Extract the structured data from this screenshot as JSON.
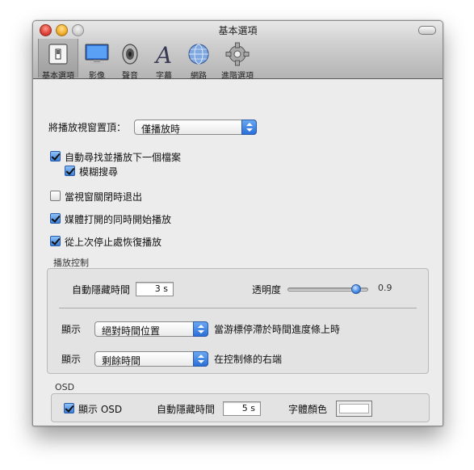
{
  "window": {
    "title": "基本選項"
  },
  "toolbar": {
    "items": [
      {
        "label": "基本選項",
        "icon": "switch-icon"
      },
      {
        "label": "影像",
        "icon": "monitor-icon"
      },
      {
        "label": "聲音",
        "icon": "speaker-icon"
      },
      {
        "label": "字幕",
        "icon": "letter-a-icon"
      },
      {
        "label": "網路",
        "icon": "globe-icon"
      },
      {
        "label": "進階選項",
        "icon": "gear-icon"
      }
    ],
    "selected": "基本選項"
  },
  "general": {
    "ontop_label": "將播放視窗置頂：",
    "ontop_value": "僅播放時",
    "auto_next_label": "自動尋找並播放下一個檔案",
    "auto_next_checked": true,
    "fuzzy_label": "模糊搜尋",
    "fuzzy_checked": true,
    "quit_on_close_label": "當視窗關閉時退出",
    "quit_on_close_checked": false,
    "play_on_open_label": "媒體打開的同時開始播放",
    "play_on_open_checked": true,
    "resume_label": "從上次停止處恢復播放",
    "resume_checked": true
  },
  "playback_control": {
    "title": "播放控制",
    "autohide_label": "自動隱藏時間",
    "autohide_value": "3 s",
    "opacity_label": "透明度",
    "opacity_value": "0.9",
    "show1_label": "顯示",
    "show1_value": "絕對時間位置",
    "show1_desc": "當游標停滯於時間進度條上時",
    "show2_label": "顯示",
    "show2_value": "剩餘時間",
    "show2_desc": "在控制條的右端"
  },
  "osd": {
    "title": "OSD",
    "show_label": "顯示 OSD",
    "show_checked": true,
    "autohide_label": "自動隱藏時間",
    "autohide_value": "5 s",
    "font_color_label": "字體顏色",
    "font_color": "#ffffff"
  },
  "colors": {
    "accent": "#3a7fd9",
    "window_bg": "#ececec"
  }
}
